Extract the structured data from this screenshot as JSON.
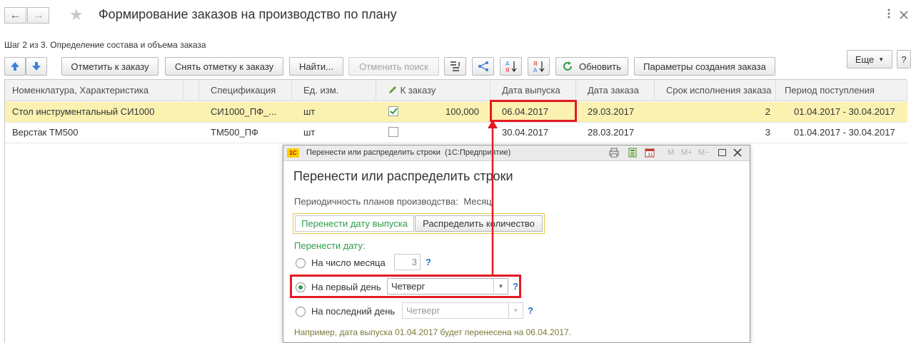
{
  "window": {
    "title": "Формирование заказов на производство по плану",
    "step": "Шаг 2 из 3. Определение состава и объема заказа"
  },
  "toolbar": {
    "mark_order": "Отметить к заказу",
    "unmark_order": "Снять отметку к заказу",
    "find": "Найти...",
    "cancel_search": "Отменить поиск",
    "refresh": "Обновить",
    "order_params": "Параметры создания заказа",
    "more": "Еще"
  },
  "table": {
    "columns": [
      "Номенклатура, Характеристика",
      "Спецификация",
      "Ед. изм.",
      "К заказу",
      "Дата выпуска",
      "Дата заказа",
      "Срок исполнения заказа",
      "Период поступления"
    ],
    "rows": [
      {
        "item": "Стол инструментальный СИ1000",
        "spec": "СИ1000_ПФ_...",
        "unit": "шт",
        "checked": true,
        "qty": "100,000",
        "release_date": "06.04.2017",
        "order_date": "29.03.2017",
        "term": "2",
        "period": "01.04.2017 - 30.04.2017"
      },
      {
        "item": "Верстак ТМ500",
        "spec": "ТМ500_ПФ",
        "unit": "шт",
        "checked": false,
        "qty": "",
        "release_date": "30.04.2017",
        "order_date": "28.03.2017",
        "term": "3",
        "period": "01.04.2017 - 30.04.2017"
      }
    ]
  },
  "dialog": {
    "window_title": "Перенести или распределить строки  (1С:Предприятие)",
    "heading": "Перенести или распределить строки",
    "periodicity_label": "Периодичность планов производства:",
    "periodicity_value": "Месяц",
    "tabs": [
      "Перенести дату выпуска",
      "Распределить количество"
    ],
    "move_date_label": "Перенести дату:",
    "opt_day_of_month": "На число месяца",
    "day_of_month_value": "3",
    "opt_first_day": "На первый день",
    "first_day_value": "Четверг",
    "opt_last_day": "На последний день",
    "last_day_value": "Четверг",
    "help_mark": "?",
    "example": "Например, дата выпуска 01.04.2017 будет перенесена на 06.04.2017.",
    "titlebar_buttons": {
      "m": "M",
      "mplus": "M+",
      "mminus": "M−"
    }
  },
  "colors": {
    "highlight_red": "#e41b23",
    "selected_row": "#fbf1b1",
    "accent_green": "#2e9c4a",
    "link_blue": "#2a6ec6",
    "arrow_red": "#e41b23"
  }
}
